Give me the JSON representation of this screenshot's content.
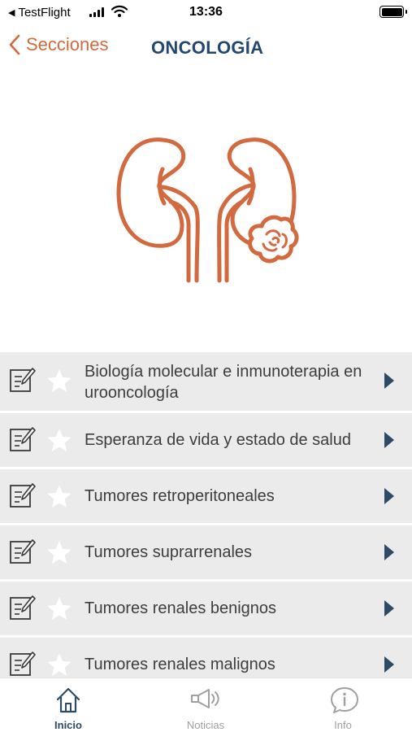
{
  "status_bar": {
    "back_app": "TestFlight",
    "time": "13:36"
  },
  "nav": {
    "back_label": "Secciones",
    "title": "ONCOLOGÍA"
  },
  "hero": {
    "icon": "kidney-tumor-illustration",
    "color": "#d2693f"
  },
  "list": {
    "items": [
      {
        "label": "Biología molecular e inmunoterapia en urooncología"
      },
      {
        "label": "Esperanza de vida y estado de salud"
      },
      {
        "label": "Tumores retroperitoneales"
      },
      {
        "label": "Tumores suprarrenales"
      },
      {
        "label": "Tumores renales benignos"
      },
      {
        "label": "Tumores renales malignos"
      }
    ]
  },
  "tabs": [
    {
      "label": "Inicio",
      "icon": "home-icon",
      "active": true
    },
    {
      "label": "Noticias",
      "icon": "megaphone-icon",
      "active": false
    },
    {
      "label": "Info",
      "icon": "info-icon",
      "active": false
    }
  ],
  "colors": {
    "accent": "#d2693f",
    "title": "#23476e",
    "row_bg": "#ebebeb",
    "chevron": "#2d4a66",
    "tab_inactive": "#a0a0a0"
  }
}
